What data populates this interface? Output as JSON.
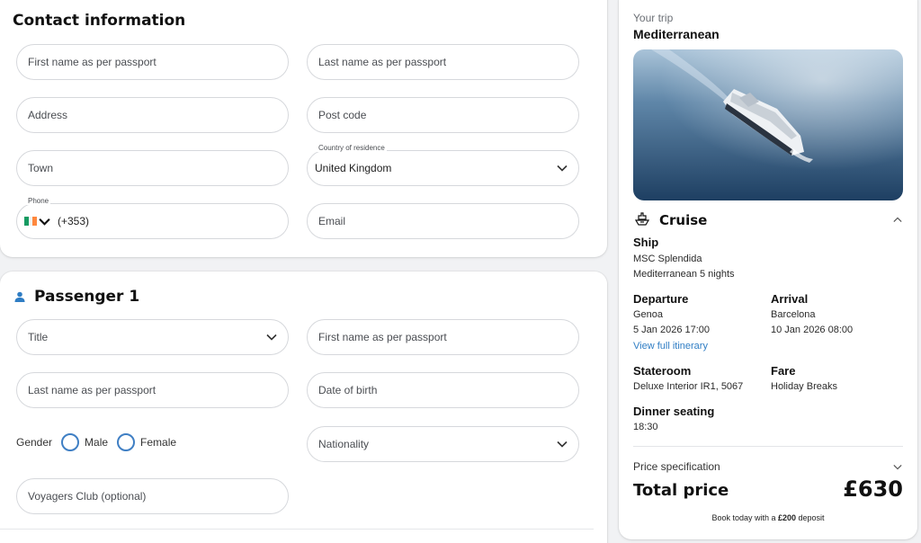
{
  "contact": {
    "title": "Contact information",
    "first_name_placeholder": "First name as per passport",
    "last_name_placeholder": "Last name as per passport",
    "address_placeholder": "Address",
    "postcode_placeholder": "Post code",
    "town_placeholder": "Town",
    "country_label": "Country of residence",
    "country_value": "United Kingdom",
    "phone_label": "Phone",
    "phone_code": "(+353)",
    "email_placeholder": "Email"
  },
  "passenger": {
    "title": "Passenger 1",
    "title_placeholder": "Title",
    "first_name_placeholder": "First name as per passport",
    "last_name_placeholder": "Last name as per passport",
    "dob_placeholder": "Date of birth",
    "gender_label": "Gender",
    "gender_options": [
      "Male",
      "Female"
    ],
    "nationality_placeholder": "Nationality",
    "voyagers_placeholder": "Voyagers Club (optional)"
  },
  "trip": {
    "eyebrow": "Your trip",
    "name": "Mediterranean",
    "cruise_heading": "Cruise",
    "ship_label": "Ship",
    "ship_name": "MSC Splendida",
    "ship_route": "Mediterranean 5 nights",
    "departure_label": "Departure",
    "departure_port": "Genoa",
    "departure_time": "5 Jan 2026 17:00",
    "itinerary_link": "View full itinerary",
    "arrival_label": "Arrival",
    "arrival_port": "Barcelona",
    "arrival_time": "10 Jan 2026 08:00",
    "stateroom_label": "Stateroom",
    "stateroom_value": "Deluxe Interior IR1, 5067",
    "fare_label": "Fare",
    "fare_value": "Holiday Breaks",
    "dinner_label": "Dinner seating",
    "dinner_value": "18:30",
    "price_spec_label": "Price specification",
    "total_label": "Total price",
    "total_value": "£630",
    "deposit_prefix": "Book today with a ",
    "deposit_amount": "£200",
    "deposit_suffix": " deposit"
  },
  "colors": {
    "accent_blue": "#2f7dc4",
    "flag_green": "#169b62",
    "flag_white": "#ffffff",
    "flag_orange": "#ff883e"
  },
  "icons": [
    "chevron-down-icon",
    "person-icon",
    "ship-icon",
    "chevron-up-icon",
    "ireland-flag-icon"
  ]
}
